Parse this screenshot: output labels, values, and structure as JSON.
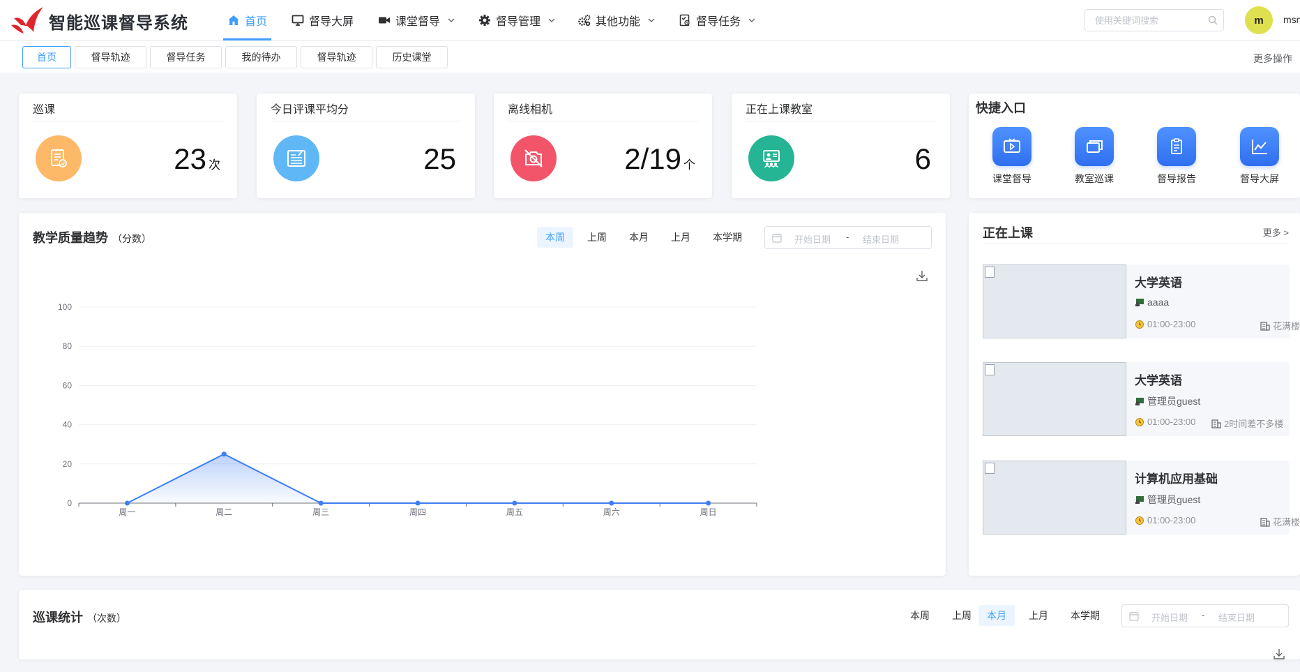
{
  "app": {
    "title": "智能巡课督导系统"
  },
  "nav": [
    {
      "label": "首页",
      "icon": "home-icon",
      "active": true
    },
    {
      "label": "督导大屏",
      "icon": "monitor-icon"
    },
    {
      "label": "课堂督导",
      "icon": "video-camera-icon",
      "dropdown": true
    },
    {
      "label": "督导管理",
      "icon": "gear-icon",
      "dropdown": true
    },
    {
      "label": "其他功能",
      "icon": "gears-icon",
      "dropdown": true
    },
    {
      "label": "督导任务",
      "icon": "task-icon",
      "dropdown": true
    }
  ],
  "search": {
    "placeholder": "使用关键词搜索"
  },
  "user": {
    "avatar_letter": "m",
    "name": "msn"
  },
  "tabs": [
    {
      "label": "首页",
      "active": true
    },
    {
      "label": "督导轨迹"
    },
    {
      "label": "督导任务"
    },
    {
      "label": "我的待办"
    },
    {
      "label": "督导轨迹"
    },
    {
      "label": "历史课堂"
    }
  ],
  "more_actions": "更多操作",
  "stats": [
    {
      "title": "巡课",
      "value": "23",
      "unit": "次",
      "icon": "document-icon",
      "color": "#fdb968"
    },
    {
      "title": "今日评课平均分",
      "value": "25",
      "unit": "",
      "icon": "score-sheet-icon",
      "color": "#5fb8f5"
    },
    {
      "title": "离线相机",
      "value": "2/19",
      "unit": "个",
      "icon": "camera-off-icon",
      "color": "#f2556a"
    },
    {
      "title": "正在上课教室",
      "value": "6",
      "unit": "",
      "icon": "classroom-icon",
      "color": "#26b594"
    }
  ],
  "quick": {
    "title": "快捷入口",
    "items": [
      {
        "label": "课堂督导",
        "icon": "tv-play-icon"
      },
      {
        "label": "教室巡课",
        "icon": "windows-icon"
      },
      {
        "label": "督导报告",
        "icon": "clipboard-icon"
      },
      {
        "label": "督导大屏",
        "icon": "line-chart-icon"
      }
    ]
  },
  "trend": {
    "title": "教学质量趋势",
    "subtitle": "（分数）",
    "periods": [
      "本周",
      "上周",
      "本月",
      "上月",
      "本学期"
    ],
    "active_period": "本周",
    "start_placeholder": "开始日期",
    "end_placeholder": "结束日期",
    "dash": "-"
  },
  "chart_data": {
    "type": "area",
    "categories": [
      "周一",
      "周二",
      "周三",
      "周四",
      "周五",
      "周六",
      "周日"
    ],
    "series": [
      {
        "values": [
          0,
          25,
          0,
          0,
          0,
          0,
          0
        ]
      }
    ],
    "yticks": [
      0,
      20,
      40,
      60,
      80,
      100
    ],
    "ylim": [
      0,
      100
    ],
    "grid": true,
    "color": "#3e7ef3"
  },
  "live": {
    "title": "正在上课",
    "more": "更多 >",
    "items": [
      {
        "course": "大学英语",
        "teacher": "aaaa",
        "time": "01:00-23:00",
        "building": "花满楼"
      },
      {
        "course": "大学英语",
        "teacher": "管理员guest",
        "time": "01:00-23:00",
        "building": "2时间差不多楼"
      },
      {
        "course": "计算机应用基础",
        "teacher": "管理员guest",
        "time": "01:00-23:00",
        "building": "花满楼"
      }
    ]
  },
  "patrol": {
    "title": "巡课统计",
    "subtitle": "（次数）",
    "periods": [
      "本周",
      "上周",
      "本月",
      "上月",
      "本学期"
    ],
    "active_period": "本月",
    "start_placeholder": "开始日期",
    "end_placeholder": "结束日期",
    "dash": "-"
  }
}
